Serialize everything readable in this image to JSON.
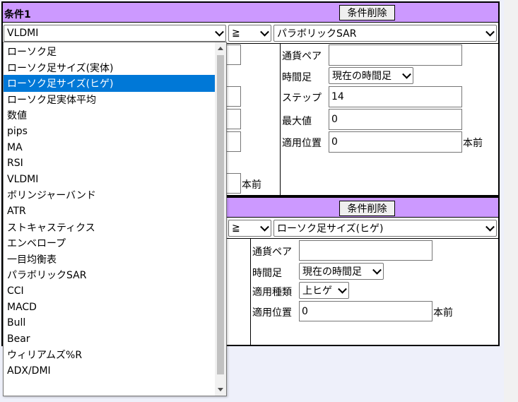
{
  "condition1": {
    "title": "条件1",
    "delete_button": "条件削除",
    "left_indicator": "VLDMI",
    "operator": "≧",
    "right_indicator": "パラボリックSAR",
    "hidden_left_offset_unit": "本前",
    "params": {
      "currency_pair_label": "通貨ペア",
      "currency_pair_value": "",
      "timeframe_label": "時間足",
      "timeframe_value": "現在の時間足",
      "step_label": "ステップ",
      "step_value": "14",
      "max_label": "最大値",
      "max_value": "0",
      "position_label": "適用位置",
      "position_value": "0",
      "position_unit": "本前"
    }
  },
  "condition2": {
    "delete_button": "条件削除",
    "operator": "≧",
    "right_indicator": "ローソク足サイズ(ヒゲ)",
    "params": {
      "currency_pair_label": "通貨ペア",
      "currency_pair_value": "",
      "timeframe_label": "時間足",
      "timeframe_value": "現在の時間足",
      "type_label": "適用種類",
      "type_value": "上ヒゲ",
      "position_label": "適用位置",
      "position_value": "0",
      "position_unit": "本前"
    }
  },
  "dropdown": {
    "selected_index": 2,
    "options": [
      "ローソク足",
      "ローソク足サイズ(実体)",
      "ローソク足サイズ(ヒゲ)",
      "ローソク足実体平均",
      "数値",
      "pips",
      "MA",
      "RSI",
      "VLDMI",
      "ボリンジャーバンド",
      "ATR",
      "ストキャスティクス",
      "エンベロープ",
      "一目均衡表",
      "パラボリックSAR",
      "CCI",
      "MACD",
      "Bull",
      "Bear",
      "ウィリアムズ%R",
      "ADX/DMI"
    ]
  }
}
